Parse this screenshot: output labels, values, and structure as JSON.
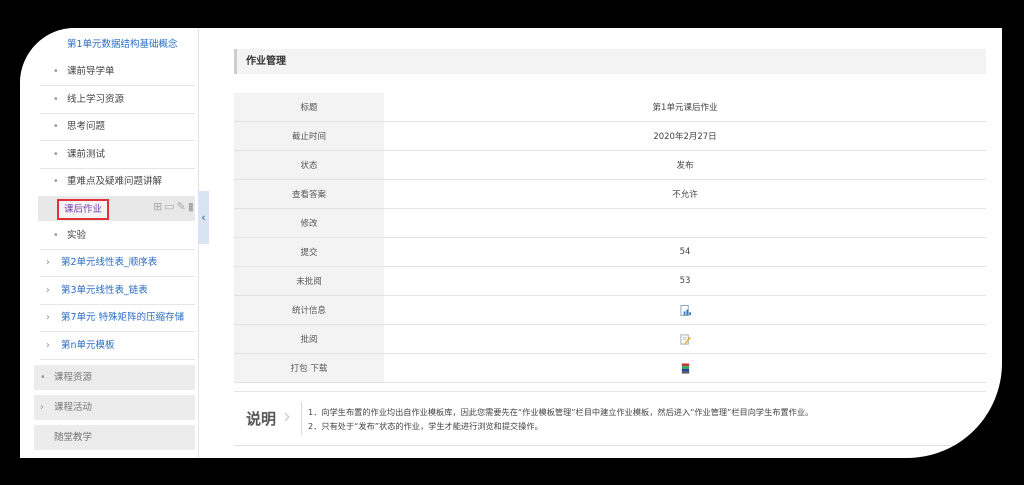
{
  "sidebar": {
    "top_unit": "第1单元数据结构基础概念",
    "items": [
      {
        "label": "课前导学单"
      },
      {
        "label": "线上学习资源"
      },
      {
        "label": "思考问题"
      },
      {
        "label": "课前测试"
      },
      {
        "label": "重难点及疑难问题讲解"
      }
    ],
    "active_item": "课后作业",
    "after_item": "实验",
    "units": [
      {
        "label": "第2单元线性表_顺序表"
      },
      {
        "label": "第3单元线性表_链表"
      },
      {
        "label": "第7单元 特殊矩阵的压缩存储"
      },
      {
        "label": "第n单元模板"
      }
    ],
    "sections": [
      {
        "label": "课程资源"
      },
      {
        "label": "课程活动"
      },
      {
        "label": "随堂教学"
      }
    ]
  },
  "main": {
    "header": "作业管理",
    "rows": [
      {
        "key": "标题",
        "value": "第1单元课后作业"
      },
      {
        "key": "截止时间",
        "value": "2020年2月27日"
      },
      {
        "key": "状态",
        "value": "发布"
      },
      {
        "key": "查看答案",
        "value": "不允许"
      },
      {
        "key": "修改",
        "value": ""
      },
      {
        "key": "提交",
        "value": "54"
      },
      {
        "key": "未批阅",
        "value": "53"
      },
      {
        "key": "统计信息",
        "icon": "chart-icon"
      },
      {
        "key": "批阅",
        "icon": "pencil-icon"
      },
      {
        "key": "打包 下载",
        "icon": "archive-icon"
      }
    ],
    "status_color": "#2f9e44",
    "answer_color": "#e67e22"
  },
  "note": {
    "title": "说明",
    "line1": "1．向学生布置的作业均出自作业模板库，因此您需要先在“作业模板管理”栏目中建立作业模板，然后进入“作业管理”栏目向学生布置作业。",
    "line2": "2．只有处于“发布”状态的作业，学生才能进行浏览和提交操作。"
  }
}
